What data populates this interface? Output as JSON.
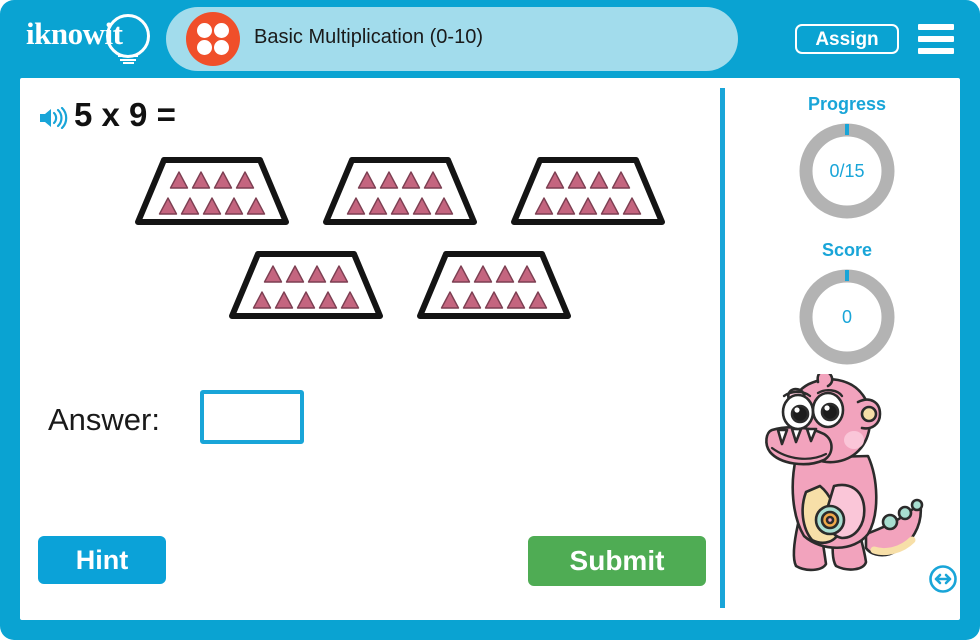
{
  "app": {
    "logo_text": "iknowit",
    "frame_color": "#0aa3d2"
  },
  "header": {
    "topic_icon": "four-dot-array-icon",
    "title": "Basic Multiplication (0-10)",
    "pill_color": "#a2dcec",
    "assign_label": "Assign",
    "menu_icon": "hamburger-menu-icon"
  },
  "question": {
    "speaker_icon": "speaker-audio-icon",
    "text": "5 x 9 =",
    "multiplicand": 5,
    "multiplier": 9,
    "groups_count": 5,
    "items_per_group": 9,
    "item_shape": "triangle",
    "item_color": "#c4657f",
    "container_shape": "trapezoid",
    "rows_layout": [
      4,
      5
    ]
  },
  "answer": {
    "label": "Answer:",
    "value": "",
    "placeholder": ""
  },
  "actions": {
    "hint_label": "Hint",
    "hint_color": "#0ba2d8",
    "submit_label": "Submit",
    "submit_color": "#4fac54"
  },
  "stats": {
    "progress": {
      "label": "Progress",
      "value": "0/15",
      "completed": 0,
      "total": 15,
      "ring_color": "#b3b3b3",
      "accent_color": "#19a5d8"
    },
    "score": {
      "label": "Score",
      "value": "0",
      "ring_color": "#b3b3b3",
      "accent_color": "#19a5d8"
    }
  },
  "mascot": {
    "name": "pink-dinosaur-mascot",
    "body_color": "#f2a3bd",
    "belly_color": "#f7dfa8"
  },
  "resize": {
    "icon": "resize-horizontal-icon",
    "color": "#19a5d8"
  }
}
